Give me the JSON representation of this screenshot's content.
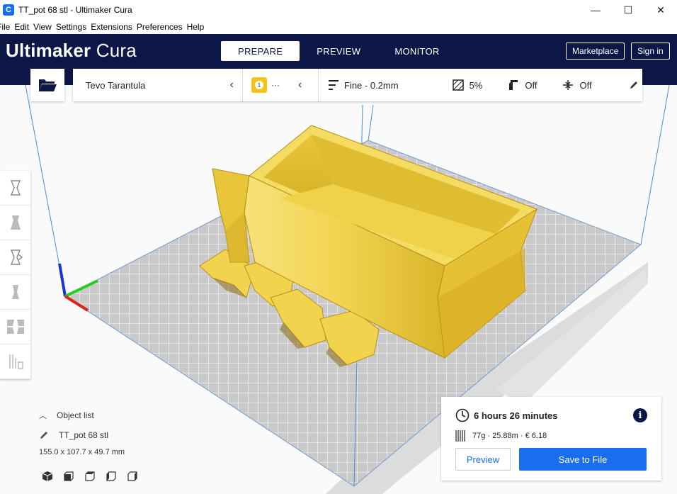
{
  "window": {
    "title": "TT_pot 68  stl - Ultimaker Cura",
    "controls": {
      "minimize": "—",
      "maximize": "☐",
      "close": "✕"
    }
  },
  "menu": [
    "File",
    "Edit",
    "View",
    "Settings",
    "Extensions",
    "Preferences",
    "Help"
  ],
  "header": {
    "brand_bold": "Ultimaker",
    "brand_light": "Cura",
    "tabs": [
      {
        "label": "PREPARE",
        "active": true
      },
      {
        "label": "PREVIEW",
        "active": false
      },
      {
        "label": "MONITOR",
        "active": false
      }
    ],
    "marketplace": "Marketplace",
    "signin": "Sign in"
  },
  "toolbar": {
    "printer": "Tevo Tarantula",
    "extruder_number": "1",
    "extruder_dots": "···",
    "profile": "Fine - 0.2mm",
    "infill": "5%",
    "support": "Off",
    "adhesion": "Off"
  },
  "object_list": {
    "title": "Object list",
    "object_name": "TT_pot 68  stl",
    "dimensions": "155.0 x 107.7 x 49.7 mm"
  },
  "summary": {
    "print_time": "6 hours 26 minutes",
    "material": "77g · 25.88m · € 6.18",
    "preview_button": "Preview",
    "save_button": "Save to File"
  },
  "colors": {
    "header_bg": "#0c1647",
    "accent_blue": "#196ef0",
    "model_yellow": "#f5dc5a",
    "extruder_yellow": "#f3c516",
    "buildplate": "#c7c7c7"
  }
}
